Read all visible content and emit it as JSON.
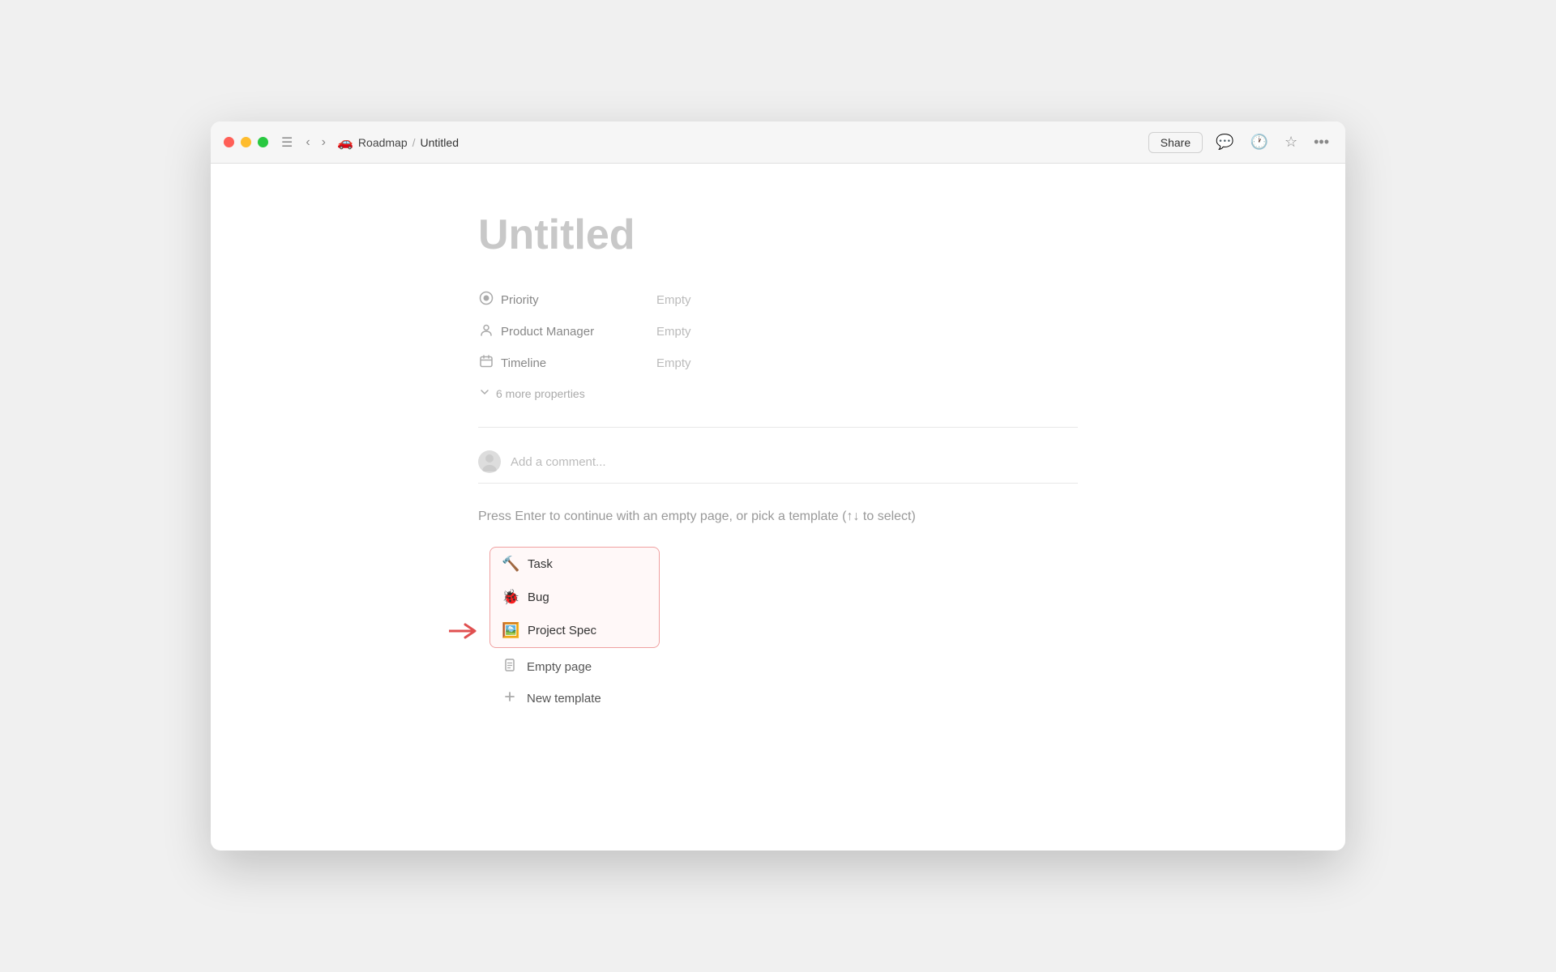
{
  "window": {
    "title": "Untitled"
  },
  "titlebar": {
    "breadcrumb_emoji": "🚗",
    "breadcrumb_parent": "Roadmap",
    "breadcrumb_separator": "/",
    "breadcrumb_current": "Untitled",
    "share_label": "Share"
  },
  "page": {
    "title": "Untitled",
    "properties": [
      {
        "id": "priority",
        "icon": "priority",
        "label": "Priority",
        "value": "Empty"
      },
      {
        "id": "product-manager",
        "icon": "person",
        "label": "Product Manager",
        "value": "Empty"
      },
      {
        "id": "timeline",
        "icon": "calendar",
        "label": "Timeline",
        "value": "Empty"
      }
    ],
    "more_properties_label": "6 more properties",
    "comment_placeholder": "Add a comment...",
    "template_hint": "Press Enter to continue with an empty page, or pick a template (↑↓ to select)"
  },
  "templates": {
    "highlighted": [
      {
        "id": "task",
        "icon": "🔨",
        "label": "Task"
      },
      {
        "id": "bug",
        "icon": "🐞",
        "label": "Bug"
      },
      {
        "id": "project-spec",
        "icon": "🖼️",
        "label": "Project Spec"
      }
    ],
    "others": [
      {
        "id": "empty-page",
        "icon": "page",
        "label": "Empty page"
      },
      {
        "id": "new-template",
        "icon": "plus",
        "label": "New template"
      }
    ]
  }
}
